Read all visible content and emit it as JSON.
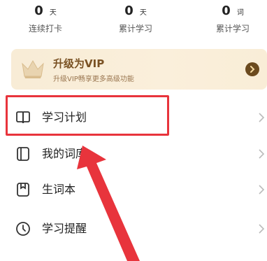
{
  "stats": [
    {
      "value": "0",
      "unit": "天",
      "label": "连续打卡"
    },
    {
      "value": "0",
      "unit": "天",
      "label": "累计学习"
    },
    {
      "value": "0",
      "unit": "词",
      "label": "累计学习"
    }
  ],
  "vip": {
    "title": "升级为VIP",
    "subtitle": "升级VIP畅享更多高级功能"
  },
  "menu": [
    {
      "label": "学习计划",
      "icon": "book-open-icon"
    },
    {
      "label": "我的词库",
      "icon": "book-icon"
    },
    {
      "label": "生词本",
      "icon": "bookmark-icon"
    },
    {
      "label": "学习提醒",
      "icon": "clock-icon"
    }
  ],
  "colors": {
    "accent_red": "#e8343c",
    "vip_brown": "#7a5224",
    "vip_bg": "#f8ecd6"
  }
}
